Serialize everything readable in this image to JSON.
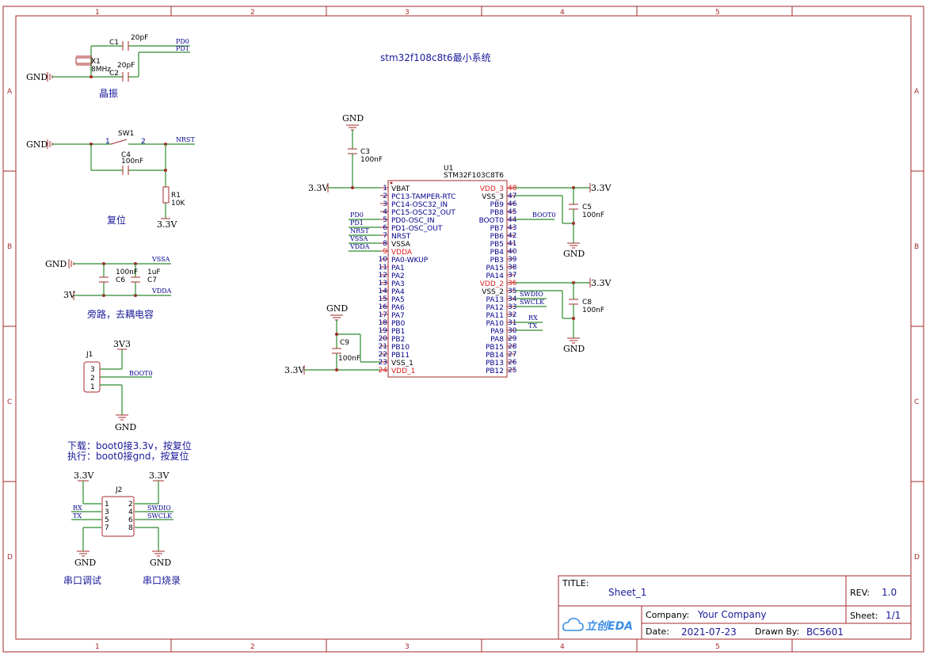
{
  "frame": {
    "col_labels": [
      "1",
      "2",
      "3",
      "4",
      "5"
    ],
    "row_labels": [
      "A",
      "B",
      "C",
      "D"
    ]
  },
  "title_main": "stm32f108c8t6最小系统",
  "sections": {
    "crystal": "晶振",
    "reset": "复位",
    "bypass": "旁路，去耦电容",
    "boot_line1": "下载：boot0接3.3v，按复位",
    "boot_line2": "执行：boot0接gnd，按复位",
    "uart_debug": "串口调试",
    "uart_flash": "串口烧录"
  },
  "crystal": {
    "c1": "C1",
    "c1_val": "20pF",
    "c2": "C2",
    "c2_val": "20pF",
    "x1": "X1",
    "x1_val": "8MHz",
    "pd0": "PD0",
    "pd1": "PD1",
    "gnd": "GND"
  },
  "reset": {
    "sw": "SW1",
    "sw_p1": "1",
    "sw_p2": "2",
    "nrst": "NRST",
    "gnd": "GND",
    "c4": "C4",
    "c4_val": "100nF",
    "r1": "R1",
    "r1_val": "10K",
    "vcc": "3.3V"
  },
  "bypass": {
    "gnd": "GND",
    "vcc": "3V",
    "vssa": "VSSA",
    "vdda": "VDDA",
    "c6": "C6",
    "c6_val": "100nF",
    "c7": "C7",
    "c7_val": "1uF"
  },
  "j1": {
    "name": "J1",
    "vcc": "3V3",
    "boot0": "BOOT0",
    "gnd": "GND",
    "pins": [
      "3",
      "2",
      "1"
    ]
  },
  "j2": {
    "name": "J2",
    "vcc_left": "3.3V",
    "vcc_right": "3.3V",
    "rx": "RX",
    "tx": "TX",
    "swdio": "SWDIO",
    "swclk": "SWCLK",
    "gnd_left": "GND",
    "gnd_right": "GND",
    "left_pins": [
      "1",
      "3",
      "5",
      "7"
    ],
    "right_pins": [
      "2",
      "4",
      "6",
      "8"
    ]
  },
  "mcu": {
    "ref": "U1",
    "part": "STM32F103C8T6",
    "left_pins": [
      {
        "n": "1",
        "name": "VBAT",
        "red": false
      },
      {
        "n": "2",
        "name": "PC13-TAMPER-RTC",
        "red": false
      },
      {
        "n": "3",
        "name": "PC14-OSC32_IN",
        "red": false
      },
      {
        "n": "4",
        "name": "PC15-OSC32_OUT",
        "red": false
      },
      {
        "n": "5",
        "name": "PD0-OSC_IN",
        "red": false
      },
      {
        "n": "6",
        "name": "PD1-OSC_OUT",
        "red": false
      },
      {
        "n": "7",
        "name": "NRST",
        "red": false
      },
      {
        "n": "8",
        "name": "VSSA",
        "red": false
      },
      {
        "n": "9",
        "name": "VDDA",
        "red": true
      },
      {
        "n": "10",
        "name": "PA0-WKUP",
        "red": false
      },
      {
        "n": "11",
        "name": "PA1",
        "red": false
      },
      {
        "n": "12",
        "name": "PA2",
        "red": false
      },
      {
        "n": "13",
        "name": "PA3",
        "red": false
      },
      {
        "n": "14",
        "name": "PA4",
        "red": false
      },
      {
        "n": "15",
        "name": "PA5",
        "red": false
      },
      {
        "n": "16",
        "name": "PA6",
        "red": false
      },
      {
        "n": "17",
        "name": "PA7",
        "red": false
      },
      {
        "n": "18",
        "name": "PB0",
        "red": false
      },
      {
        "n": "19",
        "name": "PB1",
        "red": false
      },
      {
        "n": "20",
        "name": "PB2",
        "red": false
      },
      {
        "n": "21",
        "name": "PB10",
        "red": false
      },
      {
        "n": "22",
        "name": "PB11",
        "red": false
      },
      {
        "n": "23",
        "name": "VSS_1",
        "red": false
      },
      {
        "n": "24",
        "name": "VDD_1",
        "red": true
      }
    ],
    "right_pins": [
      {
        "n": "48",
        "name": "VDD_3",
        "red": true
      },
      {
        "n": "47",
        "name": "VSS_3",
        "red": false
      },
      {
        "n": "46",
        "name": "PB9",
        "red": false
      },
      {
        "n": "45",
        "name": "PB8",
        "red": false
      },
      {
        "n": "44",
        "name": "BOOT0",
        "red": false
      },
      {
        "n": "43",
        "name": "PB7",
        "red": false
      },
      {
        "n": "42",
        "name": "PB6",
        "red": false
      },
      {
        "n": "41",
        "name": "PB5",
        "red": false
      },
      {
        "n": "40",
        "name": "PB4",
        "red": false
      },
      {
        "n": "39",
        "name": "PB3",
        "red": false
      },
      {
        "n": "38",
        "name": "PA15",
        "red": false
      },
      {
        "n": "37",
        "name": "PA14",
        "red": false
      },
      {
        "n": "36",
        "name": "VDD_2",
        "red": true
      },
      {
        "n": "35",
        "name": "VSS_2",
        "red": false
      },
      {
        "n": "34",
        "name": "PA13",
        "red": false
      },
      {
        "n": "33",
        "name": "PA12",
        "red": false
      },
      {
        "n": "32",
        "name": "PA11",
        "red": false
      },
      {
        "n": "31",
        "name": "PA10",
        "red": false
      },
      {
        "n": "30",
        "name": "PA9",
        "red": false
      },
      {
        "n": "29",
        "name": "PA8",
        "red": false
      },
      {
        "n": "28",
        "name": "PB15",
        "red": false
      },
      {
        "n": "27",
        "name": "PB14",
        "red": false
      },
      {
        "n": "26",
        "name": "PB13",
        "red": false
      },
      {
        "n": "25",
        "name": "PB12",
        "red": false
      }
    ],
    "left_nets": [
      "PD0",
      "PD1",
      "NRST",
      "VSSA",
      "VDDA"
    ],
    "right_nets": [
      "BOOT0",
      "SWDIO",
      "SWCLK",
      "RX",
      "TX"
    ]
  },
  "decoupling": {
    "c3": "C3",
    "c3_val": "100nF",
    "c5": "C5",
    "c5_val": "100nF",
    "c8": "C8",
    "c8_val": "100nF",
    "c9": "C9",
    "c9_val": "100nF",
    "gnd": "GND",
    "vcc": "3.3V"
  },
  "title_block": {
    "title_label": "TITLE:",
    "title": "Sheet_1",
    "rev_label": "REV:",
    "rev": "1.0",
    "company_label": "Company:",
    "company": "Your Company",
    "sheet_label": "Sheet:",
    "sheet": "1/1",
    "date_label": "Date:",
    "date": "2021-07-23",
    "drawn_label": "Drawn By:",
    "drawn": "BC5601",
    "logo_text": "立创EDA",
    "logo_color": "#3a8ee6"
  }
}
